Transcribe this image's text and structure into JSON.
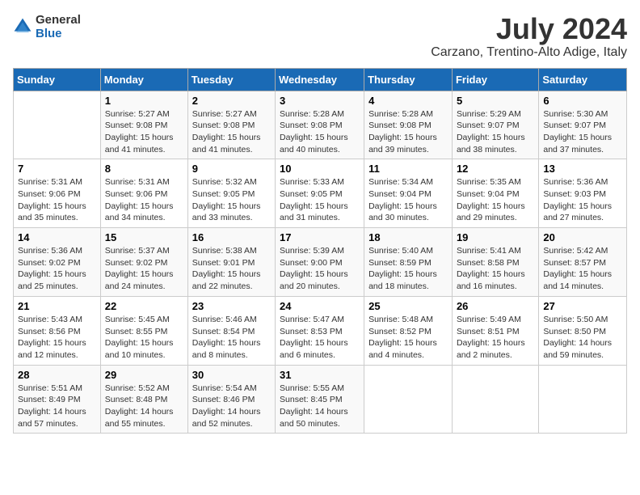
{
  "header": {
    "logo": {
      "general": "General",
      "blue": "Blue"
    },
    "title": "July 2024",
    "location": "Carzano, Trentino-Alto Adige, Italy"
  },
  "calendar": {
    "days_of_week": [
      "Sunday",
      "Monday",
      "Tuesday",
      "Wednesday",
      "Thursday",
      "Friday",
      "Saturday"
    ],
    "weeks": [
      [
        {
          "day": "",
          "sunrise": "",
          "sunset": "",
          "daylight": ""
        },
        {
          "day": "1",
          "sunrise": "Sunrise: 5:27 AM",
          "sunset": "Sunset: 9:08 PM",
          "daylight": "Daylight: 15 hours and 41 minutes."
        },
        {
          "day": "2",
          "sunrise": "Sunrise: 5:27 AM",
          "sunset": "Sunset: 9:08 PM",
          "daylight": "Daylight: 15 hours and 41 minutes."
        },
        {
          "day": "3",
          "sunrise": "Sunrise: 5:28 AM",
          "sunset": "Sunset: 9:08 PM",
          "daylight": "Daylight: 15 hours and 40 minutes."
        },
        {
          "day": "4",
          "sunrise": "Sunrise: 5:28 AM",
          "sunset": "Sunset: 9:08 PM",
          "daylight": "Daylight: 15 hours and 39 minutes."
        },
        {
          "day": "5",
          "sunrise": "Sunrise: 5:29 AM",
          "sunset": "Sunset: 9:07 PM",
          "daylight": "Daylight: 15 hours and 38 minutes."
        },
        {
          "day": "6",
          "sunrise": "Sunrise: 5:30 AM",
          "sunset": "Sunset: 9:07 PM",
          "daylight": "Daylight: 15 hours and 37 minutes."
        }
      ],
      [
        {
          "day": "7",
          "sunrise": "Sunrise: 5:31 AM",
          "sunset": "Sunset: 9:06 PM",
          "daylight": "Daylight: 15 hours and 35 minutes."
        },
        {
          "day": "8",
          "sunrise": "Sunrise: 5:31 AM",
          "sunset": "Sunset: 9:06 PM",
          "daylight": "Daylight: 15 hours and 34 minutes."
        },
        {
          "day": "9",
          "sunrise": "Sunrise: 5:32 AM",
          "sunset": "Sunset: 9:05 PM",
          "daylight": "Daylight: 15 hours and 33 minutes."
        },
        {
          "day": "10",
          "sunrise": "Sunrise: 5:33 AM",
          "sunset": "Sunset: 9:05 PM",
          "daylight": "Daylight: 15 hours and 31 minutes."
        },
        {
          "day": "11",
          "sunrise": "Sunrise: 5:34 AM",
          "sunset": "Sunset: 9:04 PM",
          "daylight": "Daylight: 15 hours and 30 minutes."
        },
        {
          "day": "12",
          "sunrise": "Sunrise: 5:35 AM",
          "sunset": "Sunset: 9:04 PM",
          "daylight": "Daylight: 15 hours and 29 minutes."
        },
        {
          "day": "13",
          "sunrise": "Sunrise: 5:36 AM",
          "sunset": "Sunset: 9:03 PM",
          "daylight": "Daylight: 15 hours and 27 minutes."
        }
      ],
      [
        {
          "day": "14",
          "sunrise": "Sunrise: 5:36 AM",
          "sunset": "Sunset: 9:02 PM",
          "daylight": "Daylight: 15 hours and 25 minutes."
        },
        {
          "day": "15",
          "sunrise": "Sunrise: 5:37 AM",
          "sunset": "Sunset: 9:02 PM",
          "daylight": "Daylight: 15 hours and 24 minutes."
        },
        {
          "day": "16",
          "sunrise": "Sunrise: 5:38 AM",
          "sunset": "Sunset: 9:01 PM",
          "daylight": "Daylight: 15 hours and 22 minutes."
        },
        {
          "day": "17",
          "sunrise": "Sunrise: 5:39 AM",
          "sunset": "Sunset: 9:00 PM",
          "daylight": "Daylight: 15 hours and 20 minutes."
        },
        {
          "day": "18",
          "sunrise": "Sunrise: 5:40 AM",
          "sunset": "Sunset: 8:59 PM",
          "daylight": "Daylight: 15 hours and 18 minutes."
        },
        {
          "day": "19",
          "sunrise": "Sunrise: 5:41 AM",
          "sunset": "Sunset: 8:58 PM",
          "daylight": "Daylight: 15 hours and 16 minutes."
        },
        {
          "day": "20",
          "sunrise": "Sunrise: 5:42 AM",
          "sunset": "Sunset: 8:57 PM",
          "daylight": "Daylight: 15 hours and 14 minutes."
        }
      ],
      [
        {
          "day": "21",
          "sunrise": "Sunrise: 5:43 AM",
          "sunset": "Sunset: 8:56 PM",
          "daylight": "Daylight: 15 hours and 12 minutes."
        },
        {
          "day": "22",
          "sunrise": "Sunrise: 5:45 AM",
          "sunset": "Sunset: 8:55 PM",
          "daylight": "Daylight: 15 hours and 10 minutes."
        },
        {
          "day": "23",
          "sunrise": "Sunrise: 5:46 AM",
          "sunset": "Sunset: 8:54 PM",
          "daylight": "Daylight: 15 hours and 8 minutes."
        },
        {
          "day": "24",
          "sunrise": "Sunrise: 5:47 AM",
          "sunset": "Sunset: 8:53 PM",
          "daylight": "Daylight: 15 hours and 6 minutes."
        },
        {
          "day": "25",
          "sunrise": "Sunrise: 5:48 AM",
          "sunset": "Sunset: 8:52 PM",
          "daylight": "Daylight: 15 hours and 4 minutes."
        },
        {
          "day": "26",
          "sunrise": "Sunrise: 5:49 AM",
          "sunset": "Sunset: 8:51 PM",
          "daylight": "Daylight: 15 hours and 2 minutes."
        },
        {
          "day": "27",
          "sunrise": "Sunrise: 5:50 AM",
          "sunset": "Sunset: 8:50 PM",
          "daylight": "Daylight: 14 hours and 59 minutes."
        }
      ],
      [
        {
          "day": "28",
          "sunrise": "Sunrise: 5:51 AM",
          "sunset": "Sunset: 8:49 PM",
          "daylight": "Daylight: 14 hours and 57 minutes."
        },
        {
          "day": "29",
          "sunrise": "Sunrise: 5:52 AM",
          "sunset": "Sunset: 8:48 PM",
          "daylight": "Daylight: 14 hours and 55 minutes."
        },
        {
          "day": "30",
          "sunrise": "Sunrise: 5:54 AM",
          "sunset": "Sunset: 8:46 PM",
          "daylight": "Daylight: 14 hours and 52 minutes."
        },
        {
          "day": "31",
          "sunrise": "Sunrise: 5:55 AM",
          "sunset": "Sunset: 8:45 PM",
          "daylight": "Daylight: 14 hours and 50 minutes."
        },
        {
          "day": "",
          "sunrise": "",
          "sunset": "",
          "daylight": ""
        },
        {
          "day": "",
          "sunrise": "",
          "sunset": "",
          "daylight": ""
        },
        {
          "day": "",
          "sunrise": "",
          "sunset": "",
          "daylight": ""
        }
      ]
    ]
  }
}
